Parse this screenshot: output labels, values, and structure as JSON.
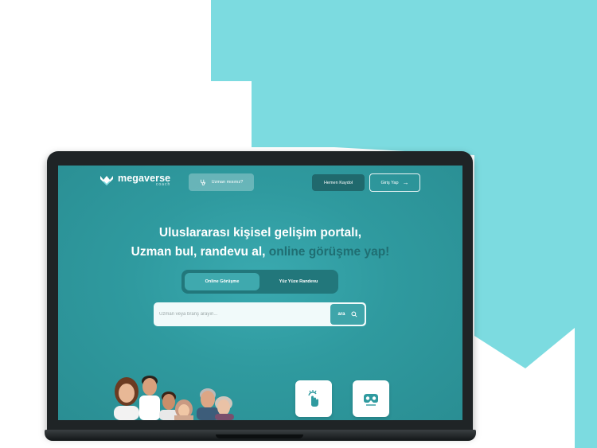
{
  "colors": {
    "accent": "#7cdbe0",
    "screen_bg": "#2f9a9f",
    "dark_button": "#20696d",
    "highlight_text": "#1f6e72",
    "search_button": "#3fa5aa"
  },
  "header": {
    "logo_brand": "megaverse",
    "logo_sub": "coach",
    "expert_button": "Uzman mısınız?",
    "register_button": "Hemen Kaydol",
    "login_button": "Giriş Yap"
  },
  "hero": {
    "line1": "Uluslararası kişisel gelişim portalı,",
    "line2_prefix": "Uzman bul, randevu al,",
    "line2_highlight": "online görüşme yap!"
  },
  "tabs": [
    {
      "label": "Online Görüşme",
      "active": true
    },
    {
      "label": "Yüz Yüze Randevu",
      "active": false
    }
  ],
  "search": {
    "placeholder": "Uzman veya branş arayın...",
    "value": "",
    "button_label": "ara"
  },
  "icons": {
    "stethoscope": "stethoscope-icon",
    "login_arrow": "arrow-right-icon",
    "search": "search-icon",
    "touch": "hand-touch-icon",
    "vr": "vr-headset-icon"
  }
}
